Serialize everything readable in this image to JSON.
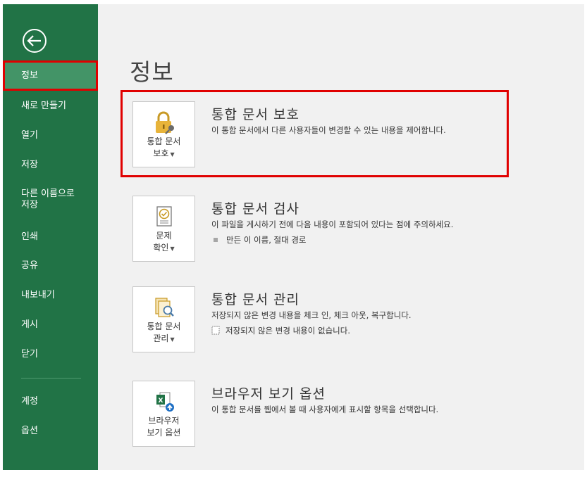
{
  "sidebar": {
    "items": [
      {
        "label": "정보"
      },
      {
        "label": "새로 만들기"
      },
      {
        "label": "열기"
      },
      {
        "label": "저장"
      },
      {
        "label": "다른 이름으로\n저장"
      },
      {
        "label": "인쇄"
      },
      {
        "label": "공유"
      },
      {
        "label": "내보내기"
      },
      {
        "label": "게시"
      },
      {
        "label": "닫기"
      },
      {
        "label": "계정"
      },
      {
        "label": "옵션"
      }
    ]
  },
  "main": {
    "title": "정보",
    "sections": [
      {
        "title": "통합 문서 보호",
        "description": "이 통합 문서에서 다른 사용자들이 변경할 수 있는 내용을 제어합니다.",
        "button_line1": "통합 문서",
        "button_line2": "보호",
        "icon": "lock-icon"
      },
      {
        "title": "통합 문서 검사",
        "description": "이 파일을 게시하기 전에 다음 내용이 포함되어 있다는 점에 주의하세요.",
        "bullet": "만든 이 이름, 절대 경로",
        "button_line1": "문제",
        "button_line2": "확인",
        "icon": "inspect-document-icon"
      },
      {
        "title": "통합 문서 관리",
        "description": "저장되지 않은 변경 내용을 체크 인, 체크 아웃, 복구합니다.",
        "bullet": "저장되지 않은 변경 내용이 없습니다.",
        "button_line1": "통합 문서",
        "button_line2": "관리",
        "icon": "manage-workbook-icon"
      },
      {
        "title": "브라우저 보기 옵션",
        "description": "이 통합 문서를 웹에서 볼 때 사용자에게 표시할 항목을 선택합니다.",
        "button_line1": "브라우저",
        "button_line2": "보기 옵션",
        "icon": "browser-view-icon"
      }
    ]
  },
  "colors": {
    "sidebar_bg": "#217346",
    "sidebar_active": "#439467",
    "main_bg": "#f1f1f1",
    "highlight": "#e00000"
  }
}
